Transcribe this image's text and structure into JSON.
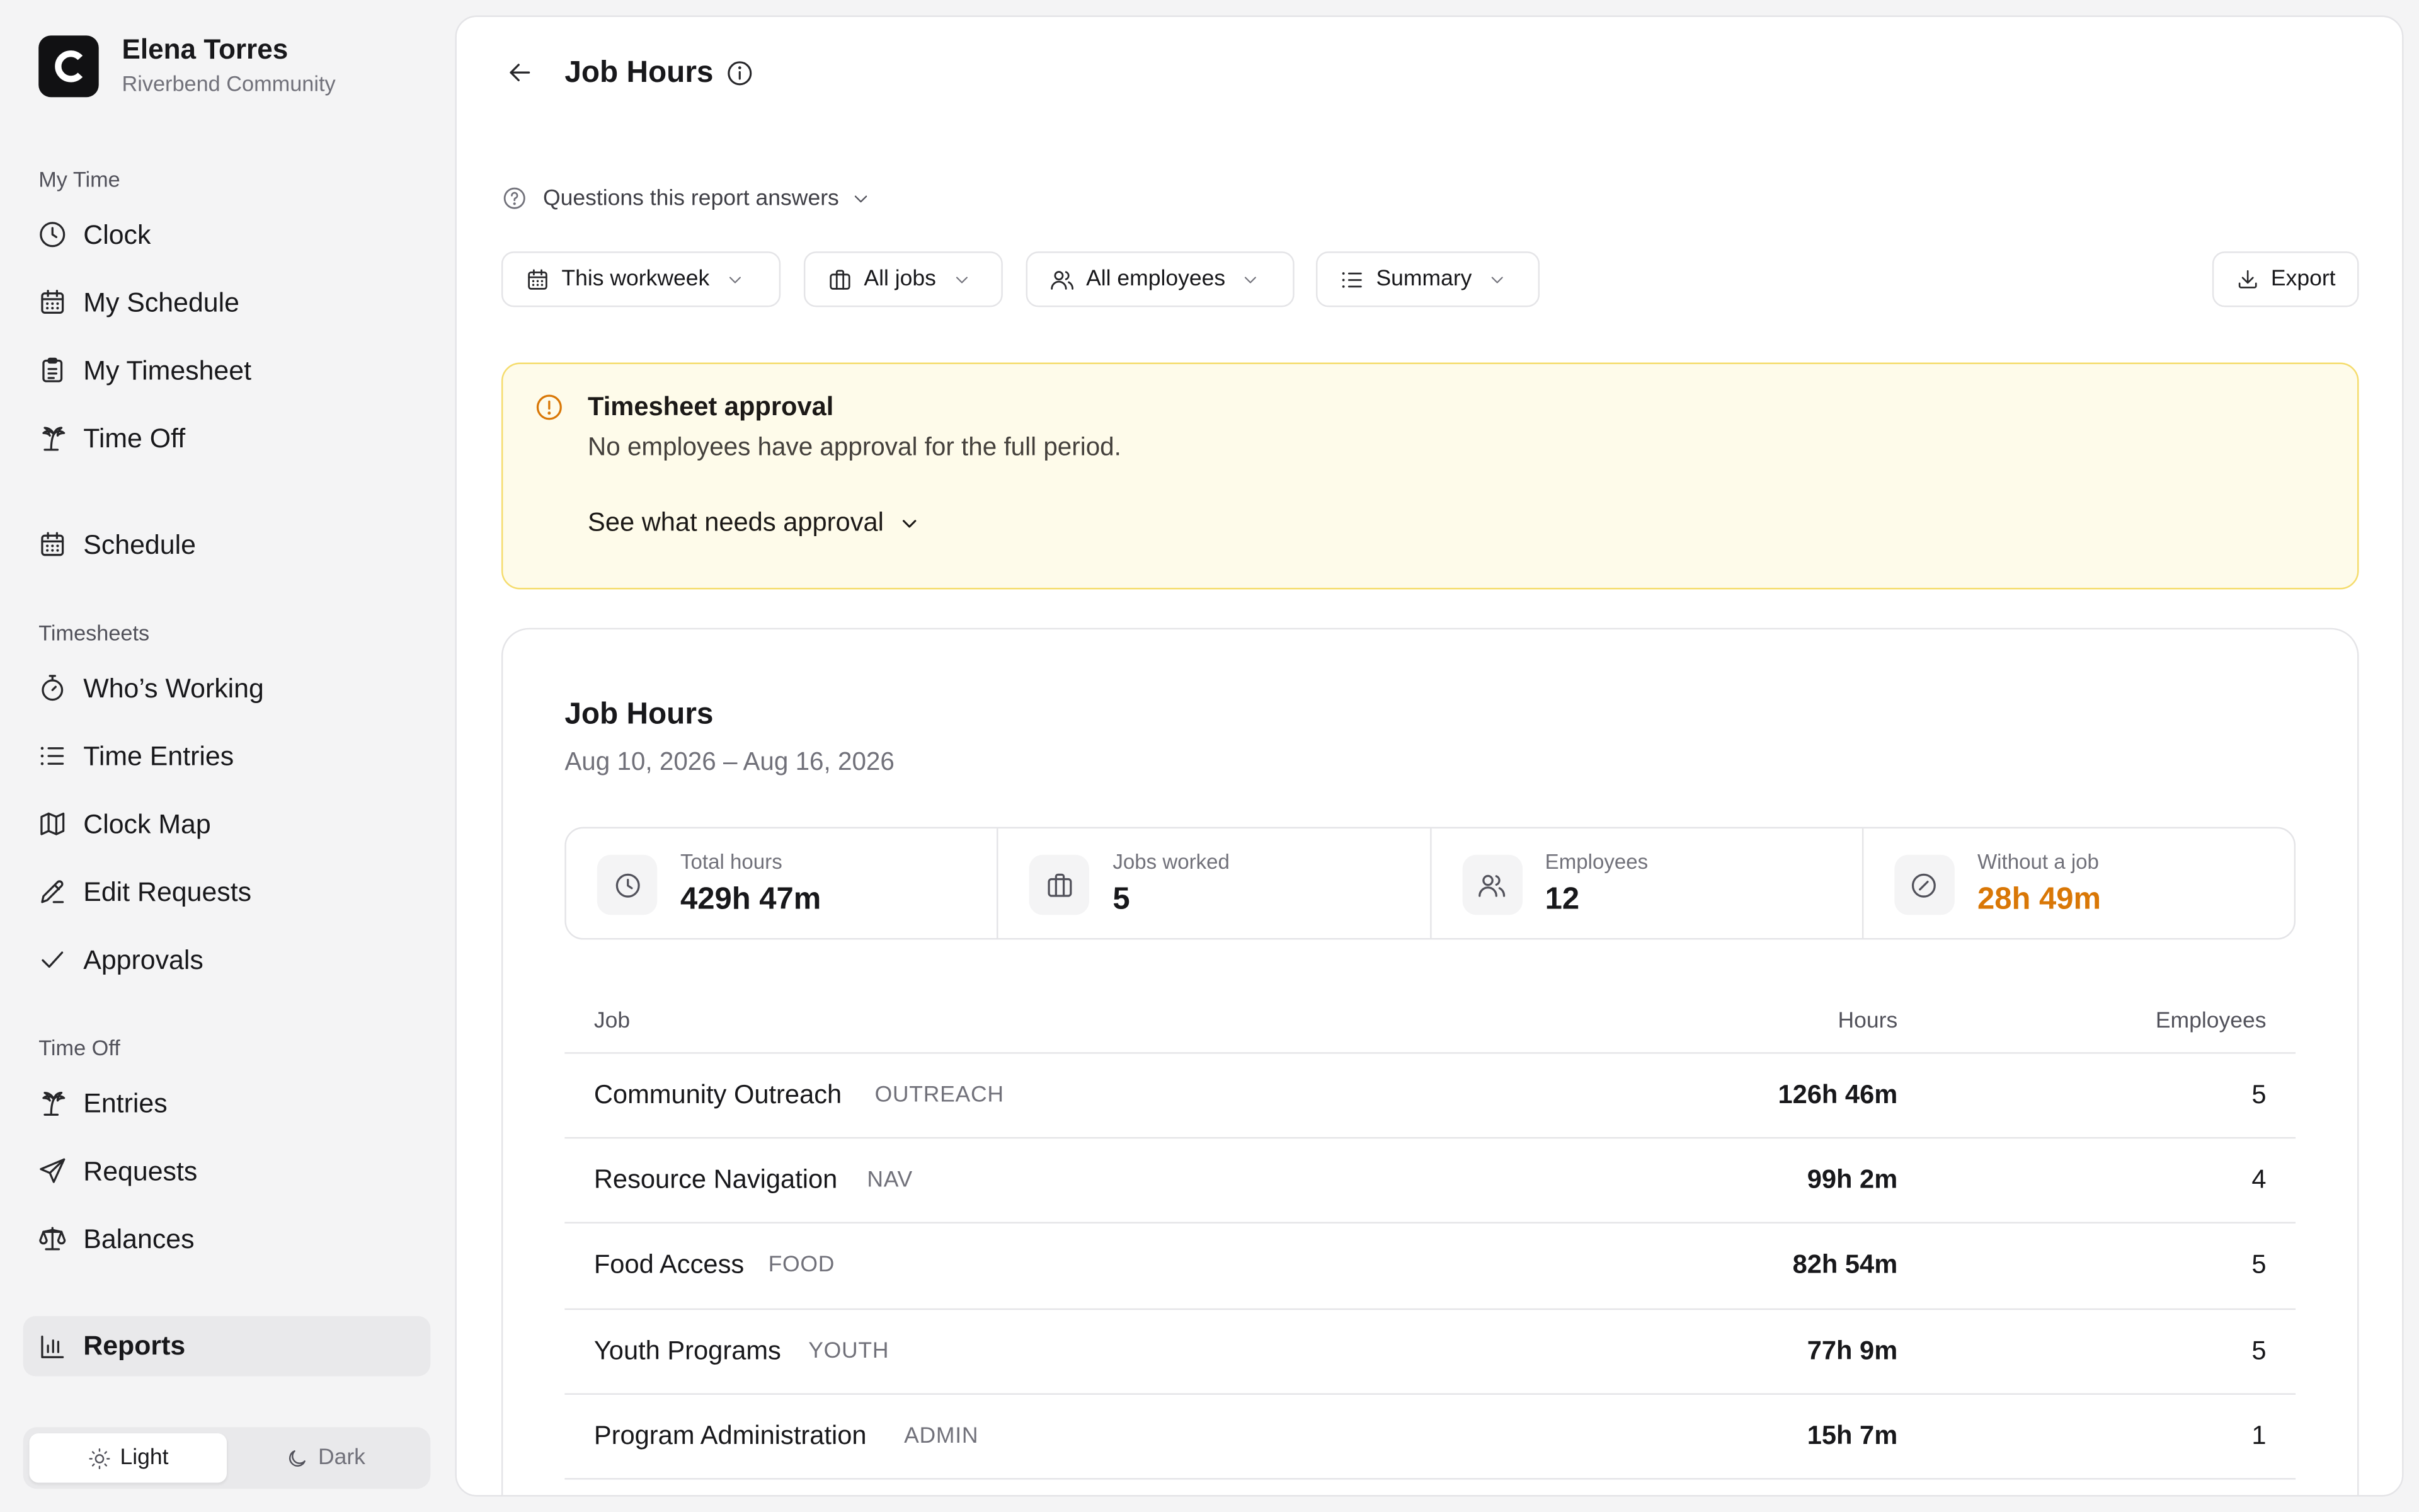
{
  "user": {
    "name": "Elena Torres",
    "org": "Riverbend Community"
  },
  "sidebar": {
    "my_time_label": "My Time",
    "my_time": [
      "Clock",
      "My Schedule",
      "My Timesheet",
      "Time Off"
    ],
    "schedule": "Schedule",
    "timesheets_label": "Timesheets",
    "timesheets": [
      "Who’s Working",
      "Time Entries",
      "Clock Map",
      "Edit Requests",
      "Approvals"
    ],
    "time_off_label": "Time Off",
    "time_off": [
      "Entries",
      "Requests",
      "Balances"
    ],
    "reports": "Reports"
  },
  "theme": {
    "light": "Light",
    "dark": "Dark",
    "selected": "Light"
  },
  "page": {
    "title": "Job Hours",
    "questions": "Questions this report answers"
  },
  "filters": {
    "period": "This workweek",
    "jobs": "All jobs",
    "employees": "All employees",
    "view": "Summary",
    "export": "Export"
  },
  "alert": {
    "title": "Timesheet approval",
    "body": "No employees have approval for the full period.",
    "link": "See what needs approval"
  },
  "report": {
    "title": "Job Hours",
    "range": "Aug 10, 2026 – Aug 16, 2026",
    "stats": {
      "total_label": "Total hours",
      "total_value": "429h 47m",
      "jobs_label": "Jobs worked",
      "jobs_value": "5",
      "employees_label": "Employees",
      "employees_value": "12",
      "nojob_label": "Without a job",
      "nojob_value": "28h 49m"
    },
    "table": {
      "headers": {
        "job": "Job",
        "hours": "Hours",
        "employees": "Employees"
      },
      "rows": [
        {
          "name": "Community Outreach",
          "code": "OUTREACH",
          "hours": "126h 46m",
          "employees": "5"
        },
        {
          "name": "Resource Navigation",
          "code": "NAV",
          "hours": "99h 2m",
          "employees": "4"
        },
        {
          "name": "Food Access",
          "code": "FOOD",
          "hours": "82h 54m",
          "employees": "5"
        },
        {
          "name": "Youth Programs",
          "code": "YOUTH",
          "hours": "77h 9m",
          "employees": "5"
        },
        {
          "name": "Program Administration",
          "code": "ADMIN",
          "hours": "15h 7m",
          "employees": "1"
        }
      ]
    }
  },
  "colors": {
    "warning": "#d97706",
    "alert_bg": "#fefbea",
    "alert_border": "#f5dc6c"
  }
}
